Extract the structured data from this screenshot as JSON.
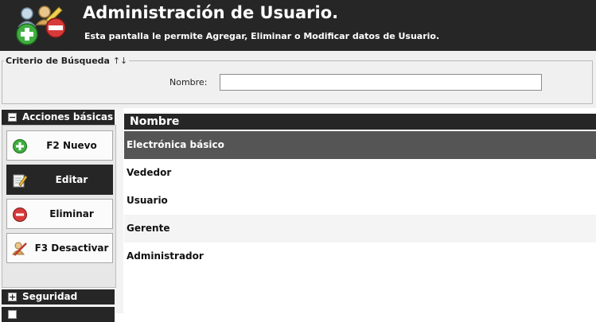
{
  "header": {
    "title": "Administración de Usuario.",
    "subtitle": "Esta pantalla le permite Agregar, Eliminar o Modificar datos de Usuario."
  },
  "search": {
    "legend": "Criterio de Búsqueda",
    "legend_arrows": "↑↓",
    "name_label": "Nombre:",
    "name_value": ""
  },
  "sidebar": {
    "sections": [
      {
        "label": "Acciones básicas",
        "toggle": "−"
      },
      {
        "label": "Seguridad",
        "toggle": "+"
      }
    ],
    "actions": [
      {
        "label": "F2 Nuevo",
        "icon": "add-icon"
      },
      {
        "label": "Editar",
        "icon": "edit-icon",
        "active": true
      },
      {
        "label": "Eliminar",
        "icon": "delete-icon"
      },
      {
        "label": "F3 Desactivar",
        "icon": "deactivate-icon"
      }
    ]
  },
  "grid": {
    "column": "Nombre",
    "rows": [
      "Electrónica básico",
      "Vededor",
      "Usuario",
      "Gerente",
      "Administrador"
    ],
    "selected_index": 0
  },
  "colors": {
    "dark": "#262626",
    "selected_row": "#555555",
    "panel": "#f0f0f0"
  }
}
